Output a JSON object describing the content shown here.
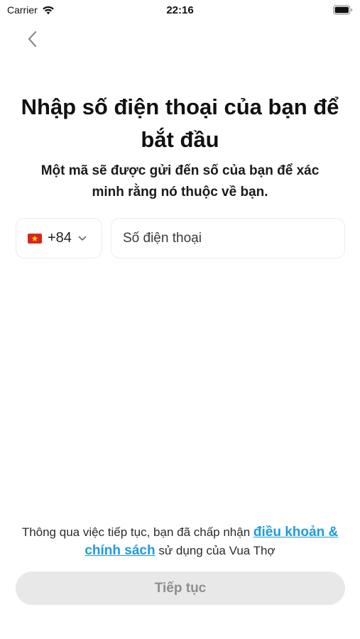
{
  "status_bar": {
    "carrier": "Carrier",
    "time": "22:16"
  },
  "header": {
    "back_icon": "chevron-left-icon"
  },
  "title": "Nhập số điện thoại của bạn để bắt đầu",
  "subtitle": "Một mã sẽ được gửi đến số của bạn để xác minh rằng nó thuộc về bạn.",
  "phone": {
    "country_flag": "vietnam-flag-icon",
    "dial_code": "+84",
    "placeholder": "Số điện thoại",
    "value": ""
  },
  "terms": {
    "prefix": "Thông qua việc tiếp tục, bạn đã chấp nhận ",
    "link": "điều khoản & chính sách",
    "suffix": " sử dụng của Vua Thợ",
    "link_color": "#1e9be0"
  },
  "continue_button": {
    "label": "Tiếp tục",
    "enabled": false
  },
  "colors": {
    "button_bg": "#e8e8e8",
    "button_text": "#8e8e8e",
    "flag_red": "#da251d",
    "flag_star": "#ffde00"
  }
}
